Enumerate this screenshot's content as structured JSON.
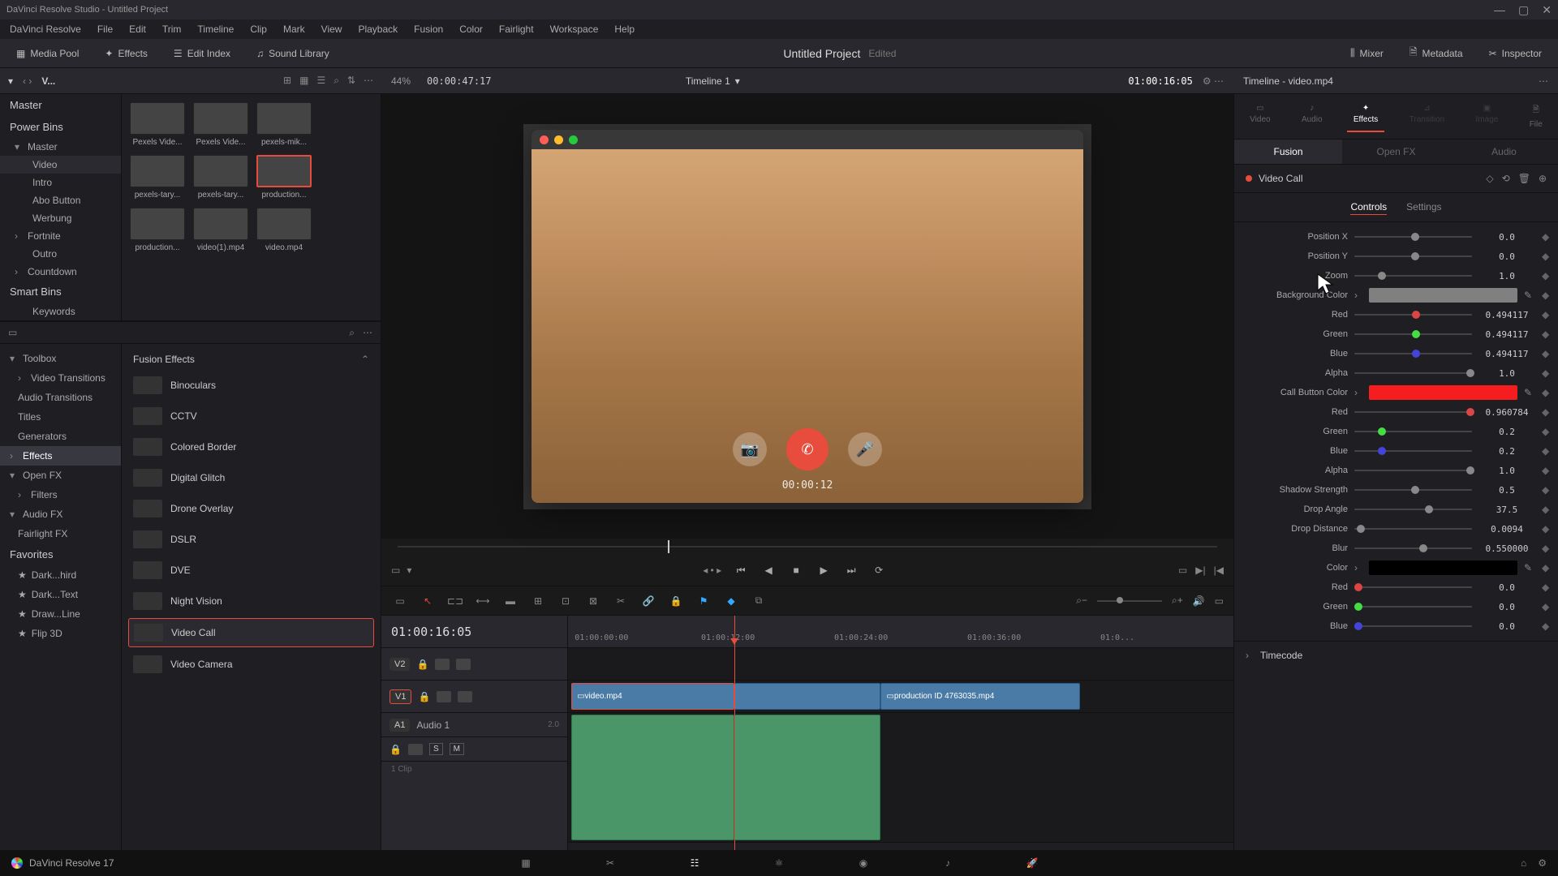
{
  "titlebar": "DaVinci Resolve Studio - Untitled Project",
  "menu": [
    "DaVinci Resolve",
    "File",
    "Edit",
    "Trim",
    "Timeline",
    "Clip",
    "Mark",
    "View",
    "Playback",
    "Fusion",
    "Color",
    "Fairlight",
    "Workspace",
    "Help"
  ],
  "toolbar": {
    "media_pool": "Media Pool",
    "effects": "Effects",
    "edit_index": "Edit Index",
    "sound_library": "Sound Library",
    "project": "Untitled Project",
    "edited": "Edited",
    "mixer": "Mixer",
    "metadata": "Metadata",
    "inspector": "Inspector"
  },
  "header": {
    "bin_label": "V...",
    "zoom": "44%",
    "src_tc": "00:00:47:17",
    "timeline_name": "Timeline 1",
    "rec_tc": "01:00:16:05",
    "inspector_title": "Timeline - video.mp4"
  },
  "bins": {
    "master": "Master",
    "power": "Power Bins",
    "pb_master": "Master",
    "items": [
      "Video",
      "Intro",
      "Abo Button",
      "Werbung",
      "Fortnite",
      "Outro",
      "Countdown"
    ],
    "smart": "Smart Bins",
    "keywords": "Keywords"
  },
  "clips": [
    "Pexels Vide...",
    "Pexels Vide...",
    "pexels-mik...",
    "pexels-tary...",
    "pexels-tary...",
    "production...",
    "production...",
    "video(1).mp4",
    "video.mp4"
  ],
  "toolbox": {
    "header": "Toolbox",
    "cats": [
      "Video Transitions",
      "Audio Transitions",
      "Titles",
      "Generators",
      "Effects",
      "Open FX",
      "Filters",
      "Audio FX",
      "Fairlight FX"
    ],
    "favorites": "Favorites",
    "fav_items": [
      "Dark...hird",
      "Dark...Text",
      "Draw...Line",
      "Flip 3D"
    ]
  },
  "fusion_effects": {
    "header": "Fusion Effects",
    "items": [
      "Binoculars",
      "CCTV",
      "Colored Border",
      "Digital Glitch",
      "Drone Overlay",
      "DSLR",
      "DVE",
      "Night Vision",
      "Video Call",
      "Video Camera"
    ]
  },
  "call_overlay": {
    "time": "00:00:12"
  },
  "timeline": {
    "tc": "01:00:16:05",
    "ticks": [
      "01:00:00:00",
      "01:00:12:00",
      "01:00:24:00",
      "01:00:36:00",
      "01:0..."
    ],
    "v2": "V2",
    "v1": "V1",
    "a1": "A1",
    "audio1": "Audio 1",
    "a1_meta": "2.0",
    "a1_clips": "1 Clip",
    "clip1": "video.mp4",
    "clip2": "production ID 4763035.mp4"
  },
  "inspector": {
    "tabs": [
      "Video",
      "Audio",
      "Effects",
      "Transition",
      "Image",
      "File"
    ],
    "subtabs": [
      "Fusion",
      "Open FX",
      "Audio"
    ],
    "effect_name": "Video Call",
    "ctrl_tabs": [
      "Controls",
      "Settings"
    ],
    "params": {
      "posx": {
        "label": "Position X",
        "value": "0.0"
      },
      "posy": {
        "label": "Position Y",
        "value": "0.0"
      },
      "zoom": {
        "label": "Zoom",
        "value": "1.0"
      },
      "bgcolor": {
        "label": "Background Color",
        "swatch": "#808080"
      },
      "bg_r": {
        "label": "Red",
        "value": "0.494117"
      },
      "bg_g": {
        "label": "Green",
        "value": "0.494117"
      },
      "bg_b": {
        "label": "Blue",
        "value": "0.494117"
      },
      "bg_a": {
        "label": "Alpha",
        "value": "1.0"
      },
      "btncolor": {
        "label": "Call Button Color",
        "swatch": "#f51d1d"
      },
      "btn_r": {
        "label": "Red",
        "value": "0.960784"
      },
      "btn_g": {
        "label": "Green",
        "value": "0.2"
      },
      "btn_b": {
        "label": "Blue",
        "value": "0.2"
      },
      "btn_a": {
        "label": "Alpha",
        "value": "1.0"
      },
      "shadow": {
        "label": "Shadow Strength",
        "value": "0.5"
      },
      "angle": {
        "label": "Drop Angle",
        "value": "37.5"
      },
      "dist": {
        "label": "Drop Distance",
        "value": "0.0094"
      },
      "blur": {
        "label": "Blur",
        "value": "0.550000"
      },
      "scolor": {
        "label": "Color",
        "swatch": "#000000"
      },
      "s_r": {
        "label": "Red",
        "value": "0.0"
      },
      "s_g": {
        "label": "Green",
        "value": "0.0"
      },
      "s_b": {
        "label": "Blue",
        "value": "0.0"
      }
    },
    "timecode_section": "Timecode"
  },
  "footer": {
    "version": "DaVinci Resolve 17"
  }
}
